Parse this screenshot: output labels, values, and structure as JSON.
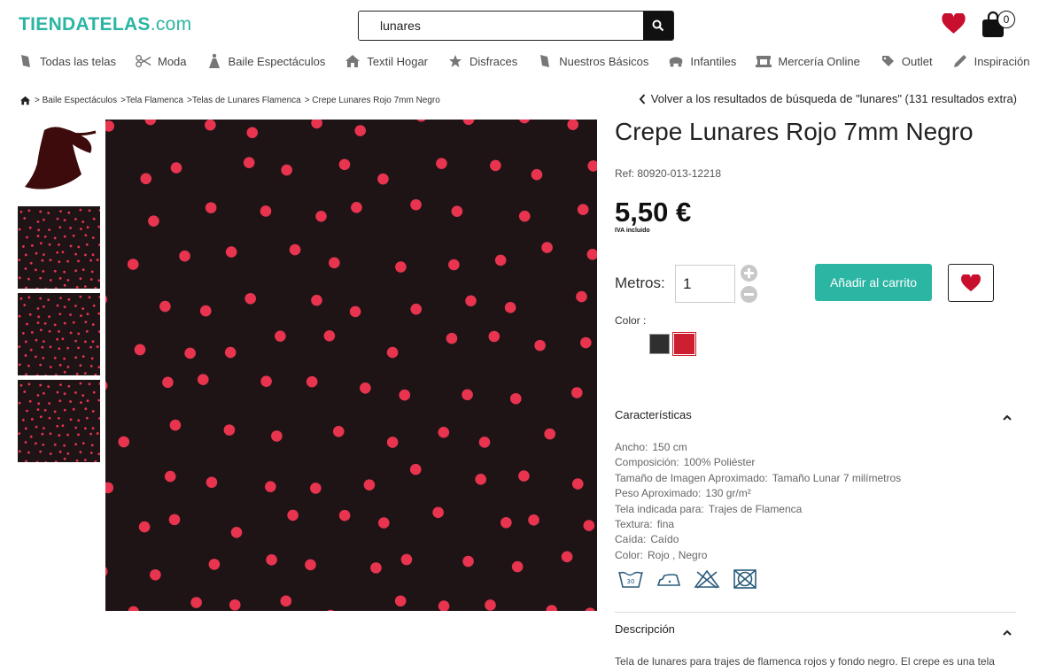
{
  "header": {
    "logo_brand": "TIENDATELAS",
    "logo_domain": ".com",
    "search_value": "lunares",
    "cart_count": "0",
    "icons": [
      "search-icon",
      "heart-icon",
      "shopping-bag-icon"
    ],
    "brand_color": "#2bb5a3"
  },
  "nav": {
    "items": [
      {
        "label": "Todas las telas",
        "icon": "fabric-roll-icon"
      },
      {
        "label": "Moda",
        "icon": "scissors-icon"
      },
      {
        "label": "Baile Espectáculos",
        "icon": "dancer-icon"
      },
      {
        "label": "Textil Hogar",
        "icon": "home-icon"
      },
      {
        "label": "Disfraces",
        "icon": "star-icon"
      },
      {
        "label": "Nuestros Básicos",
        "icon": "fabric-roll-icon"
      },
      {
        "label": "Infantiles",
        "icon": "baby-car-icon"
      },
      {
        "label": "Mercería Online",
        "icon": "sewing-machine-icon"
      },
      {
        "label": "Outlet",
        "icon": "tag-icon"
      },
      {
        "label": "Inspiración",
        "icon": "pencil-icon"
      }
    ]
  },
  "breadcrumb": {
    "items": [
      "> Baile Espectáculos",
      ">Tela Flamenca",
      ">Telas de Lunares Flamenca",
      "> Crepe Lunares Rojo 7mm Negro"
    ],
    "back_text": "Volver a los resultados de búsqueda de \"lunares\" (131 resultados extra)"
  },
  "product": {
    "title": "Crepe Lunares Rojo 7mm Negro",
    "ref": "Ref: 80920-013-12218",
    "price": "5,50 €",
    "iva": "IVA incluido",
    "metros_label": "Metros:",
    "qty": "1",
    "add_label": "Añadir al carrito",
    "color_label": "Color :",
    "swatches": [
      {
        "name": "negro",
        "hex": "#2f2f2f"
      },
      {
        "name": "rojo",
        "hex": "#cc1f2f",
        "selected": true
      }
    ]
  },
  "characteristics": {
    "title": "Características",
    "rows": [
      {
        "k": "Ancho:",
        "v": "150 cm"
      },
      {
        "k": "Composición:",
        "v": "100% Poliéster"
      },
      {
        "k": "Tamaño de Imagen Aproximado:",
        "v": "Tamaño Lunar 7 milímetros"
      },
      {
        "k": "Peso Aproximado:",
        "v": "130 gr/m²"
      },
      {
        "k": "Tela indicada para:",
        "v": "Trajes de Flamenca"
      },
      {
        "k": "Textura:",
        "v": "fina"
      },
      {
        "k": "Caída:",
        "v": "Caído"
      },
      {
        "k": "Color:",
        "v": "Rojo , Negro"
      }
    ],
    "care_icons": [
      "wash-30-icon",
      "iron-low-icon",
      "no-bleach-icon",
      "no-tumble-dry-icon"
    ],
    "wash_temp": "30"
  },
  "description": {
    "title": "Descripción",
    "text": "Tela de lunares para trajes de flamenca rojos y fondo negro. El crepe es una tela"
  },
  "image_colors": {
    "background": "#1e1416",
    "dots": "#e8344e"
  }
}
